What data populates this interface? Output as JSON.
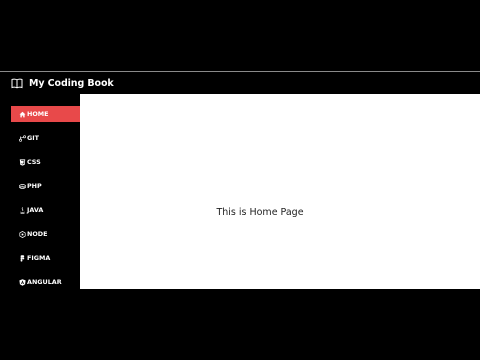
{
  "app": {
    "title": "My Coding Book",
    "title_icon": "book-icon"
  },
  "sidebar": {
    "items": [
      {
        "label": "HOME",
        "icon": "home-icon",
        "active": true
      },
      {
        "label": "GIT",
        "icon": "git-icon",
        "active": false
      },
      {
        "label": "CSS",
        "icon": "css3-icon",
        "active": false
      },
      {
        "label": "PHP",
        "icon": "php-icon",
        "active": false
      },
      {
        "label": "JAVA",
        "icon": "java-icon",
        "active": false
      },
      {
        "label": "NODE",
        "icon": "node-icon",
        "active": false
      },
      {
        "label": "FIGMA",
        "icon": "figma-icon",
        "active": false
      },
      {
        "label": "ANGULAR",
        "icon": "angular-icon",
        "active": false
      }
    ]
  },
  "main": {
    "message": "This is Home Page"
  },
  "colors": {
    "accent": "#e8494a",
    "background": "#000000",
    "content_bg": "#ffffff"
  }
}
